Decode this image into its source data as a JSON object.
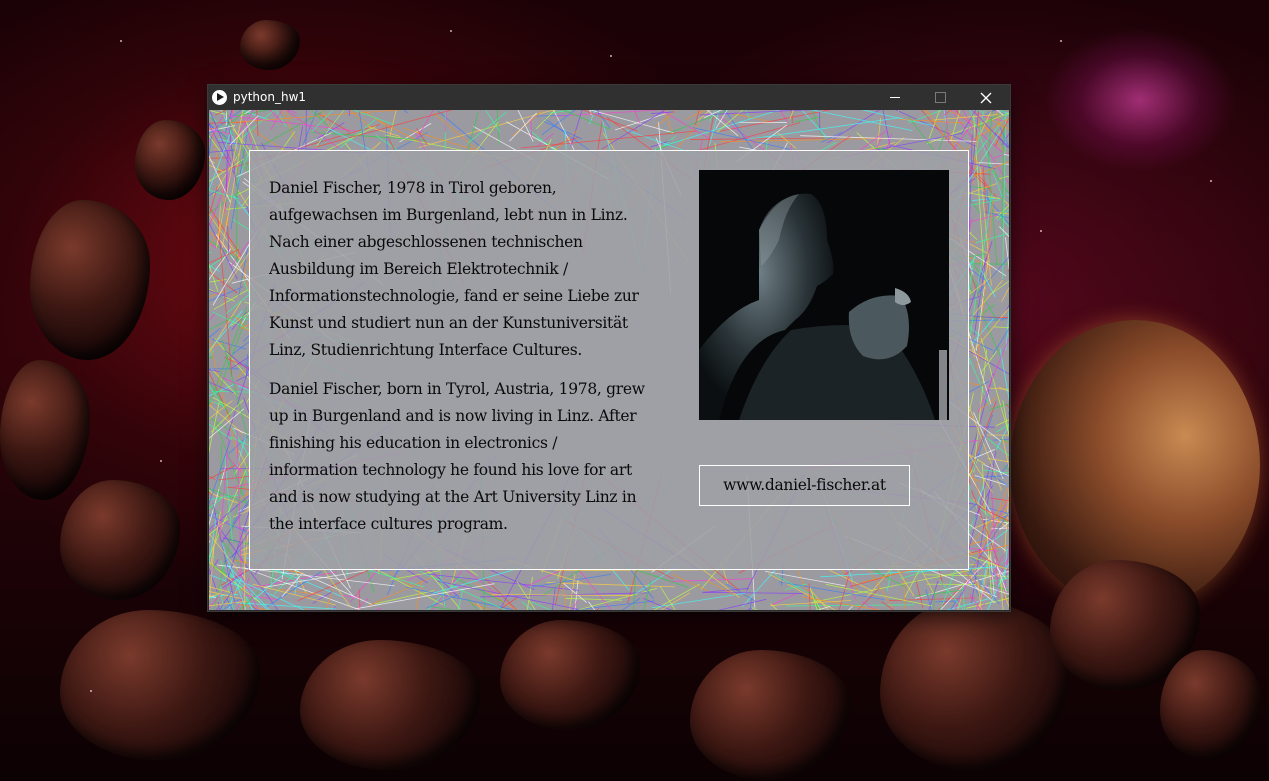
{
  "window": {
    "title": "python_hw1",
    "app_icon": "play-icon",
    "controls": {
      "minimize_icon": "minimize-icon",
      "maximize_icon": "maximize-icon",
      "close_icon": "close-icon"
    }
  },
  "content": {
    "bio_german_lines": [
      "Daniel Fischer, 1978 in Tirol geboren,",
      "aufgewachsen im Burgenland, lebt nun in Linz.",
      "Nach einer abgeschlossenen technischen",
      "Ausbildung im Bereich Elektrotechnik /",
      "Informationstechnologie, fand er seine Liebe zur",
      "Kunst und studiert nun an der Kunstuniversität",
      "Linz, Studienrichtung Interface Cultures."
    ],
    "bio_english_lines": [
      "Daniel Fischer, born in Tyrol, Austria, 1978, grew",
      "up in Burgenland and is now living in Linz. After",
      "finishing his education in electronics /",
      "information technology he found his love for art",
      "and is now studying at the Art University Linz in",
      "the interface cultures program."
    ],
    "portrait": "portrait-photo",
    "website_label": "www.daniel-fischer.at"
  },
  "colors": {
    "titlebar": "#303030",
    "panel_border": "#ffffff",
    "text": "#0a0a0a"
  }
}
